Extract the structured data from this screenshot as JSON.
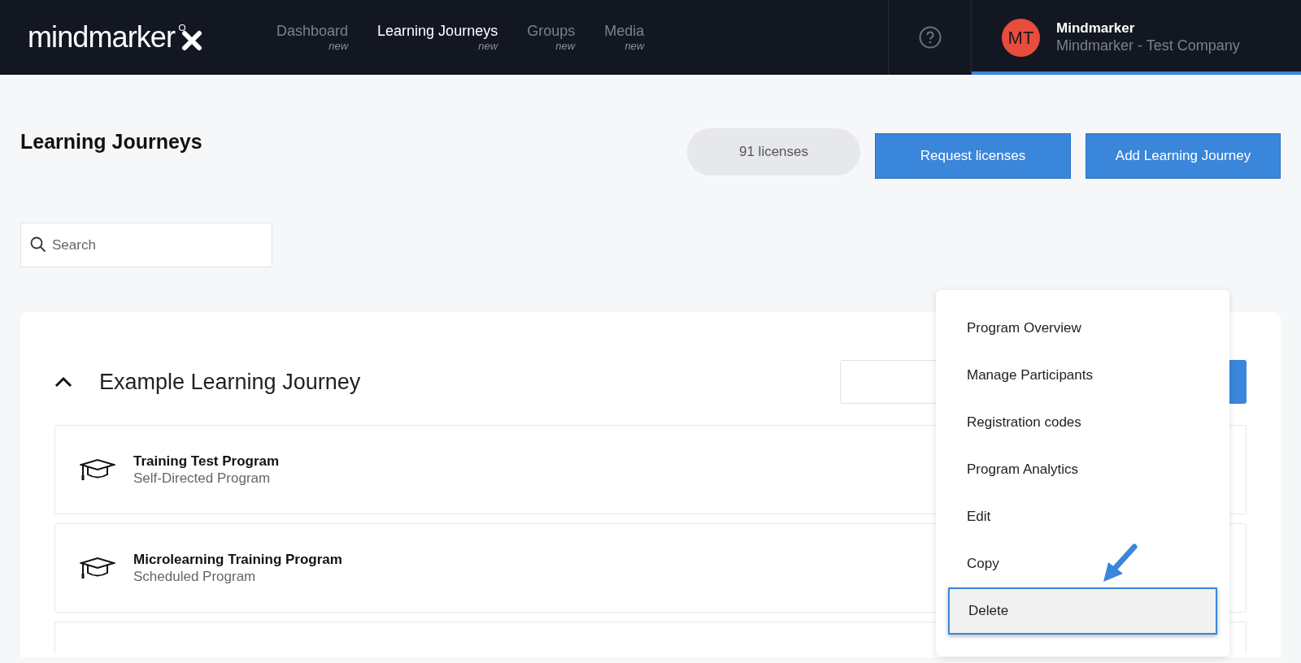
{
  "header": {
    "logo": "mindmarker",
    "nav": [
      {
        "label": "Dashboard",
        "badge": "new",
        "selected": false
      },
      {
        "label": "Learning Journeys",
        "badge": "new",
        "selected": true
      },
      {
        "label": "Groups",
        "badge": "new",
        "selected": false
      },
      {
        "label": "Media",
        "badge": "new",
        "selected": false
      }
    ],
    "user": {
      "initials": "MT",
      "name": "Mindmarker",
      "company": "Mindmarker - Test Company",
      "selected": true
    }
  },
  "page": {
    "title": "Learning Journeys",
    "licenses": "91 licenses",
    "buttons": [
      "Request licenses",
      "Add Learning Journey"
    ]
  },
  "search": {
    "placeholder": "Search"
  },
  "journey": {
    "title": "Example Learning Journey",
    "expanded": true,
    "programs": [
      {
        "kind": "full",
        "name": "Training Test Program",
        "type": "Self-Directed Program"
      },
      {
        "kind": "full",
        "name": "Microlearning Training Program",
        "type": "Scheduled Program"
      },
      {
        "kind": "cut"
      }
    ]
  },
  "context_menu": [
    {
      "label": "Program Overview",
      "selected": false
    },
    {
      "label": "Manage Participants",
      "selected": false
    },
    {
      "label": "Registration codes",
      "selected": false
    },
    {
      "label": "Program Analytics",
      "selected": false
    },
    {
      "label": "Edit",
      "selected": false
    },
    {
      "label": "Copy",
      "selected": false
    },
    {
      "label": "Delete",
      "selected": true
    }
  ]
}
